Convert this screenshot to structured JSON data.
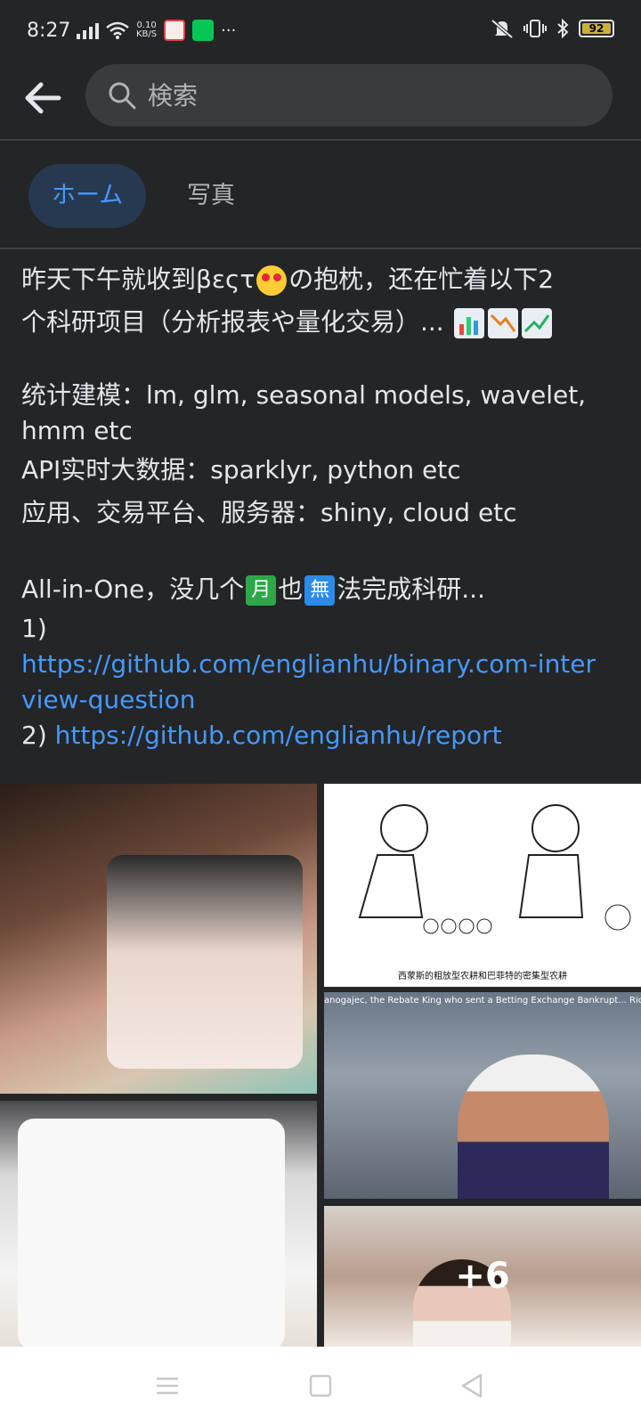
{
  "status_bar": {
    "time": "8:27",
    "net_speed_value": "0.10",
    "net_speed_unit": "KB/S",
    "overflow": "···",
    "battery_level": "92"
  },
  "search": {
    "placeholder": "検索"
  },
  "tabs": [
    {
      "label": "ホーム",
      "active": true
    },
    {
      "label": "写真",
      "active": false
    }
  ],
  "post": {
    "line1_a": "昨天下午就收到βεςτ",
    "line1_b": "の抱枕，还在忙着以下2",
    "line2": "个科研项目（分析报表や量化交易）...",
    "line3": "统计建模：lm, glm, seasonal models, wavelet,",
    "line4": "hmm etc",
    "line5": "API实时大数据：sparklyr, python etc",
    "line6": "应用、交易平台、服务器：shiny, cloud etc",
    "line7_a": "All-in-One，没几个",
    "emoji_month": "月",
    "line7_b": "也",
    "emoji_none": "無",
    "line7_c": "法完成科研...",
    "item1_num": "1)",
    "link1_part1": "https://github.com/englianhu/binary.com-inter",
    "link1_part2": "view-question",
    "item2_num": "2)",
    "link2": "https://github.com/englianhu/report"
  },
  "photos": {
    "caption_cartoon": "西蒙斯的粗放型农耕和巴菲特的密集型农耕",
    "caption_video": "anogajec, the Rebate King who sent a Betting Exchange Bankrupt... Rich Fr...",
    "more_count": "+6"
  },
  "colors": {
    "background": "#242526",
    "link": "#4599ff",
    "tab_active_bg": "#263951",
    "search_bg": "#3a3b3c"
  }
}
